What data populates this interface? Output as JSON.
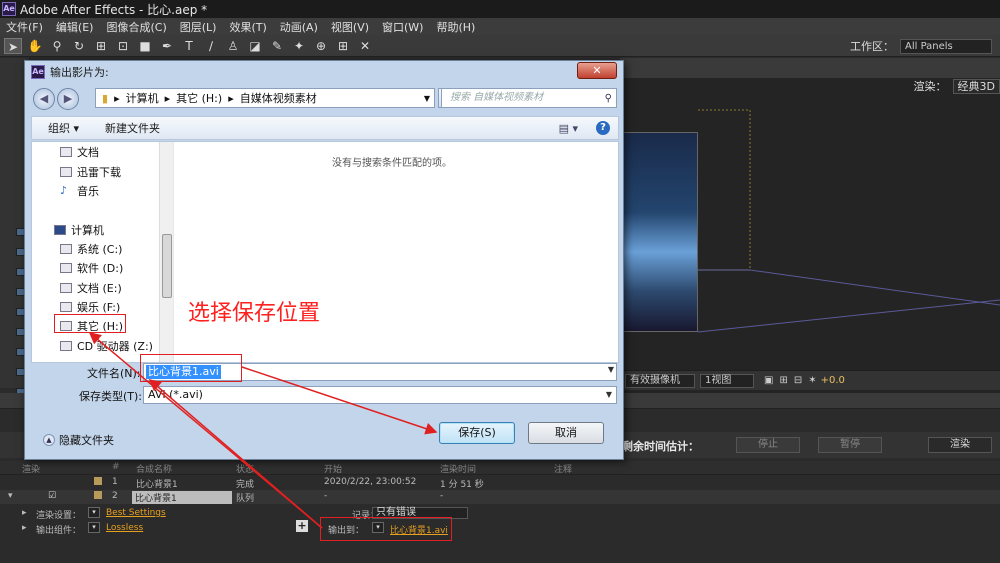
{
  "app": {
    "title": "Adobe After Effects - 比心.aep *",
    "logo": "Ae",
    "menu": [
      "文件(F)",
      "编辑(E)",
      "图像合成(C)",
      "图层(L)",
      "效果(T)",
      "动画(A)",
      "视图(V)",
      "窗口(W)",
      "帮助(H)"
    ],
    "workspace_label": "工作区：",
    "workspace_value": "All Panels",
    "renderer_label": "渲染：",
    "renderer_value": "经典3D"
  },
  "dialog": {
    "title": "输出影片为:",
    "close_label": "✕",
    "breadcrumb": [
      "计算机",
      "其它 (H:)",
      "自媒体视频素材"
    ],
    "search_placeholder": "搜索 自媒体视频素材",
    "organize_label": "组织 ▾",
    "new_folder_label": "新建文件夹",
    "empty_message": "没有与搜索条件匹配的项。",
    "nav_items": [
      {
        "label": "文档",
        "icon": "document-library-icon"
      },
      {
        "label": "迅雷下载",
        "icon": "download-folder-icon"
      },
      {
        "label": "音乐",
        "icon": "music-icon"
      },
      {
        "label": "计算机",
        "icon": "computer-icon"
      },
      {
        "label": "系统 (C:)",
        "icon": "system-drive-icon"
      },
      {
        "label": "软件 (D:)",
        "icon": "drive-icon"
      },
      {
        "label": "文档 (E:)",
        "icon": "drive-icon"
      },
      {
        "label": "娱乐 (F:)",
        "icon": "drive-icon"
      },
      {
        "label": "其它 (H:)",
        "icon": "drive-icon"
      },
      {
        "label": "CD 驱动器 (Z:)",
        "icon": "cd-drive-icon"
      }
    ],
    "filename_label": "文件名(N):",
    "filename_value": "比心背景1.avi",
    "filetype_label": "保存类型(T):",
    "filetype_value": "AVI (*.avi)",
    "hide_folders_label": "隐藏文件夹",
    "save_label": "保存(S)",
    "cancel_label": "取消"
  },
  "annotation": {
    "instruction": "选择保存位置"
  },
  "composition": {
    "camera_value": "有效摄像机",
    "view_value": "1视图",
    "exposure_value": "+0.0"
  },
  "render_queue": {
    "estimate_label": "剩余时间估计：",
    "stop_label": "停止",
    "pause_label": "暂停",
    "render_label": "渲染",
    "columns": [
      "渲染",
      "#",
      "合成名称",
      "状态",
      "开始",
      "渲染时间",
      "注释"
    ],
    "rows": [
      {
        "num": "1",
        "name": "比心背景1",
        "status": "完成",
        "start": "2020/2/22, 23:00:52",
        "duration": "1 分 51 秒"
      },
      {
        "num": "2",
        "name": "比心背景1",
        "status": "队列",
        "start": "-",
        "duration": "-"
      }
    ],
    "render_settings_label": "渲染设置：",
    "render_settings_value": "Best Settings",
    "output_module_label": "输出组件：",
    "output_module_value": "Lossless",
    "log_label": "记录：",
    "log_value": "只有错误",
    "output_to_label": "输出到：",
    "output_to_value": "比心背景1.avi"
  },
  "colors": {
    "annotation_red": "#e02020",
    "link_orange": "#e8a020",
    "selection_blue": "#3390ff"
  }
}
